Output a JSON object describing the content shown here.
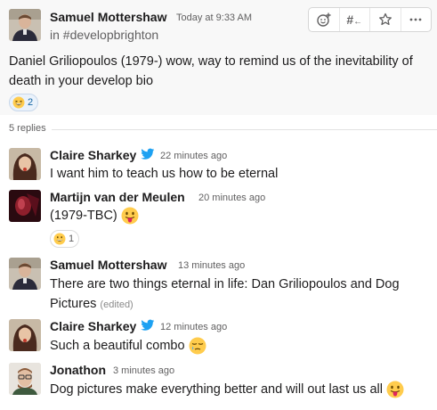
{
  "parent": {
    "author": "Samuel Mottershaw",
    "time": "Today at 9:33 AM",
    "channel": "in #developbrighton",
    "text": "Daniel Griliopoulos (1979-) wow, way to remind us of the inevitability of death in your develop bio",
    "reaction": {
      "emoji": "grinning-squint-emoji",
      "count": "2"
    }
  },
  "toolbar": {
    "icons": [
      "add-reaction-icon",
      "share-to-channel-icon",
      "star-icon",
      "more-icon"
    ],
    "channel_glyph": "#"
  },
  "replies_label": "5 replies",
  "replies": [
    {
      "author": "Claire Sharkey",
      "time": "22 minutes ago",
      "text": "I want him to teach us how to be eternal",
      "twitter": true
    },
    {
      "author": "Martijn van der Meulen",
      "time": "20 minutes ago",
      "text": "(1979-TBC)",
      "emoji": "tongue-out-emoji",
      "reaction": {
        "emoji": "grinning-emoji",
        "count": "1"
      }
    },
    {
      "author": "Samuel Mottershaw",
      "time": "13 minutes ago",
      "text": "There are two things eternal in life: Dan Griliopoulos and Dog Pictures",
      "edited": "(edited)"
    },
    {
      "author": "Claire Sharkey",
      "time": "12 minutes ago",
      "text": "Such a beautiful combo",
      "emoji": "sleepy-face-emoji",
      "twitter": true
    },
    {
      "author": "Jonathon",
      "time": "3 minutes ago",
      "text": "Dog pictures make everything better and will out last us all",
      "emoji": "tongue-out-emoji"
    }
  ],
  "colors": {
    "accent": "#1264a3",
    "twitter": "#1da1f2",
    "emoji_yellow": "#ffcc4d"
  }
}
